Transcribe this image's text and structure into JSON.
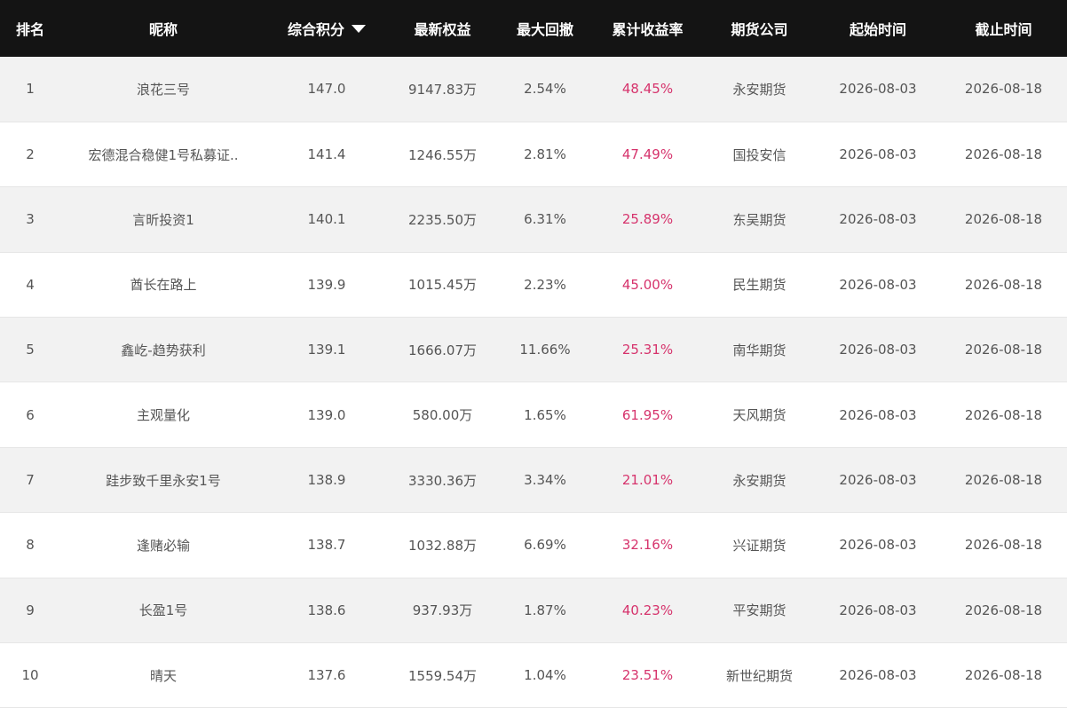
{
  "colors": {
    "header_bg": "#141414",
    "header_text": "#ffffff",
    "row_odd_bg": "#f2f2f2",
    "row_even_bg": "#ffffff",
    "cell_text": "#555555",
    "return_text": "#d6336c"
  },
  "table": {
    "headers": {
      "rank": "排名",
      "nickname": "昵称",
      "score": "综合积分",
      "equity": "最新权益",
      "drawdown": "最大回撤",
      "return": "累计收益率",
      "broker": "期货公司",
      "start": "起始时间",
      "end": "截止时间"
    },
    "sort_icon": "triangle-down-icon",
    "rows": [
      {
        "rank": "1",
        "nickname": "浪花三号",
        "score": "147.0",
        "equity": "9147.83万",
        "drawdown": "2.54%",
        "return": "48.45%",
        "broker": "永安期货",
        "start": "2026-08-03",
        "end": "2026-08-18"
      },
      {
        "rank": "2",
        "nickname": "宏德混合稳健1号私募证..",
        "score": "141.4",
        "equity": "1246.55万",
        "drawdown": "2.81%",
        "return": "47.49%",
        "broker": "国投安信",
        "start": "2026-08-03",
        "end": "2026-08-18"
      },
      {
        "rank": "3",
        "nickname": "言昕投资1",
        "score": "140.1",
        "equity": "2235.50万",
        "drawdown": "6.31%",
        "return": "25.89%",
        "broker": "东吴期货",
        "start": "2026-08-03",
        "end": "2026-08-18"
      },
      {
        "rank": "4",
        "nickname": "酋长在路上",
        "score": "139.9",
        "equity": "1015.45万",
        "drawdown": "2.23%",
        "return": "45.00%",
        "broker": "民生期货",
        "start": "2026-08-03",
        "end": "2026-08-18"
      },
      {
        "rank": "5",
        "nickname": "鑫屹-趋势获利",
        "score": "139.1",
        "equity": "1666.07万",
        "drawdown": "11.66%",
        "return": "25.31%",
        "broker": "南华期货",
        "start": "2026-08-03",
        "end": "2026-08-18"
      },
      {
        "rank": "6",
        "nickname": "主观量化",
        "score": "139.0",
        "equity": "580.00万",
        "drawdown": "1.65%",
        "return": "61.95%",
        "broker": "天风期货",
        "start": "2026-08-03",
        "end": "2026-08-18"
      },
      {
        "rank": "7",
        "nickname": "跬步致千里永安1号",
        "score": "138.9",
        "equity": "3330.36万",
        "drawdown": "3.34%",
        "return": "21.01%",
        "broker": "永安期货",
        "start": "2026-08-03",
        "end": "2026-08-18"
      },
      {
        "rank": "8",
        "nickname": "逢赌必输",
        "score": "138.7",
        "equity": "1032.88万",
        "drawdown": "6.69%",
        "return": "32.16%",
        "broker": "兴证期货",
        "start": "2026-08-03",
        "end": "2026-08-18"
      },
      {
        "rank": "9",
        "nickname": "长盈1号",
        "score": "138.6",
        "equity": "937.93万",
        "drawdown": "1.87%",
        "return": "40.23%",
        "broker": "平安期货",
        "start": "2026-08-03",
        "end": "2026-08-18"
      },
      {
        "rank": "10",
        "nickname": "晴天",
        "score": "137.6",
        "equity": "1559.54万",
        "drawdown": "1.04%",
        "return": "23.51%",
        "broker": "新世纪期货",
        "start": "2026-08-03",
        "end": "2026-08-18"
      }
    ]
  }
}
